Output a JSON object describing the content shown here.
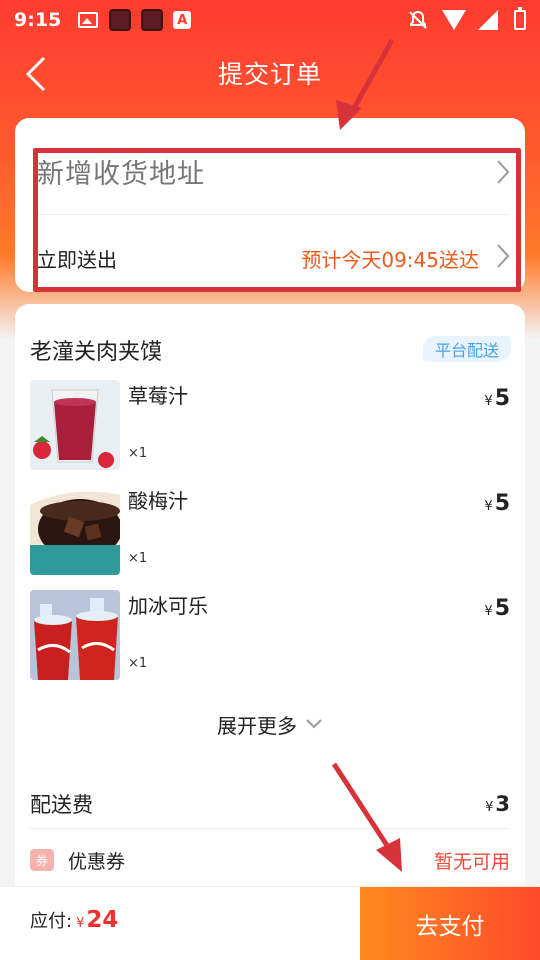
{
  "status_bar": {
    "time": "9:15",
    "icons": [
      "image-icon",
      "app-icon",
      "app-icon",
      "text-app-icon",
      "mute-bell-icon",
      "wifi-icon",
      "cell-signal-icon",
      "battery-charging-icon"
    ],
    "a_label": "A"
  },
  "header": {
    "title": "提交订单",
    "back_icon": "chevron-left-icon"
  },
  "address": {
    "add_label": "新增收货地址",
    "deliver_label": "立即送出",
    "eta": "预计今天09:45送达"
  },
  "order": {
    "store_name": "老潼关肉夹馍",
    "badge": "平台配送",
    "items": [
      {
        "name": "草莓汁",
        "qty": "×1",
        "price": "5",
        "currency": "¥"
      },
      {
        "name": "酸梅汁",
        "qty": "×1",
        "price": "5",
        "currency": "¥"
      },
      {
        "name": "加冰可乐",
        "qty": "×1",
        "price": "5",
        "currency": "¥"
      }
    ],
    "expand_label": "展开更多",
    "delivery_fee_label": "配送费",
    "delivery_fee_currency": "¥",
    "delivery_fee": "3",
    "coupon_icon_text": "券",
    "coupon_label": "优惠券",
    "coupon_value": "暂无可用"
  },
  "bottom": {
    "payable_label": "应付:",
    "currency": "¥",
    "payable_amount": "24",
    "pay_button": "去支付"
  },
  "colors": {
    "brand_red": "#ff3b30",
    "price_red": "#f0302a",
    "eta_orange": "#f05a1a",
    "badge_blue": "#4a9fe8",
    "annotation_red": "#d6323a"
  }
}
